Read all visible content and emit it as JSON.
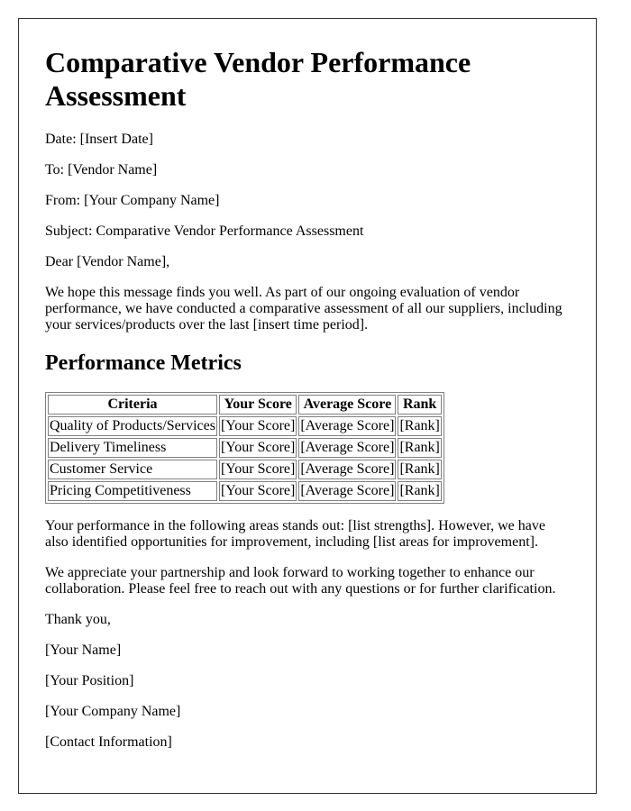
{
  "title": "Comparative Vendor Performance Assessment",
  "header_fields": {
    "date": "Date: [Insert Date]",
    "to": "To: [Vendor Name]",
    "from": "From: [Your Company Name]",
    "subject": "Subject: Comparative Vendor Performance Assessment"
  },
  "salutation": "Dear [Vendor Name],",
  "intro_paragraph": "We hope this message finds you well. As part of our ongoing evaluation of vendor performance, we have conducted a comparative assessment of all our suppliers, including your services/products over the last [insert time period].",
  "metrics_section": {
    "heading": "Performance Metrics",
    "columns": [
      "Criteria",
      "Your Score",
      "Average Score",
      "Rank"
    ],
    "rows": [
      [
        "Quality of Products/Services",
        "[Your Score]",
        "[Average Score]",
        "[Rank]"
      ],
      [
        "Delivery Timeliness",
        "[Your Score]",
        "[Average Score]",
        "[Rank]"
      ],
      [
        "Customer Service",
        "[Your Score]",
        "[Average Score]",
        "[Rank]"
      ],
      [
        "Pricing Competitiveness",
        "[Your Score]",
        "[Average Score]",
        "[Rank]"
      ]
    ]
  },
  "strengths_paragraph": "Your performance in the following areas stands out: [list strengths]. However, we have also identified opportunities for improvement, including [list areas for improvement].",
  "closing_paragraph": "We appreciate your partnership and look forward to working together to enhance our collaboration. Please feel free to reach out with any questions or for further clarification.",
  "signoff": "Thank you,",
  "signature": {
    "name": "[Your Name]",
    "position": "[Your Position]",
    "company": "[Your Company Name]",
    "contact": "[Contact Information]"
  }
}
